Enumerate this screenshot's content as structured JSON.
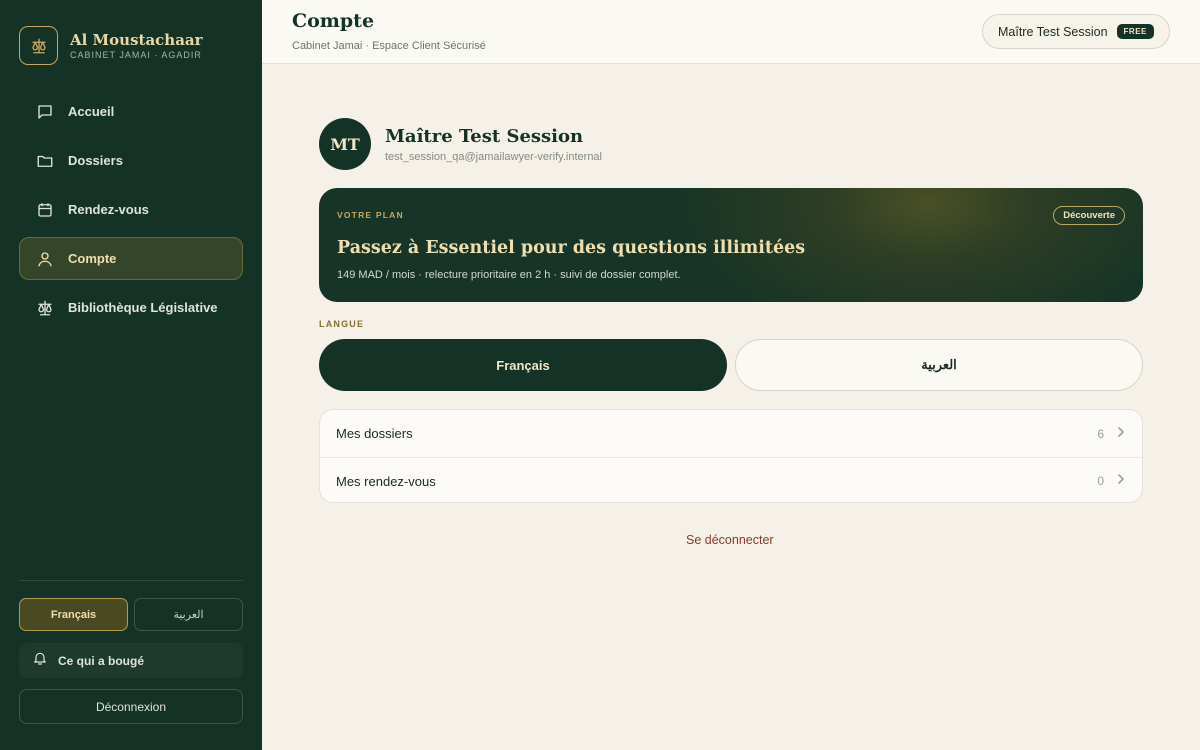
{
  "colors": {
    "sidebar_bg": "#143326",
    "accent_gold": "#c9a85c",
    "page_bg": "#f5f1e8",
    "logout_red": "#8a3b2a"
  },
  "brand": {
    "name": "Al Moustachaar",
    "subtitle": "CABINET JAMAI · AGADIR",
    "icon": "scales-icon"
  },
  "sidebar": {
    "items": [
      {
        "label": "Accueil",
        "icon": "message-square-icon",
        "active": false
      },
      {
        "label": "Dossiers",
        "icon": "folder-icon",
        "active": false
      },
      {
        "label": "Rendez-vous",
        "icon": "calendar-icon",
        "active": false
      },
      {
        "label": "Compte",
        "icon": "user-icon",
        "active": true
      },
      {
        "label": "Bibliothèque Législative",
        "icon": "scales-icon",
        "active": false
      }
    ],
    "lang_fr": "Français",
    "lang_ar": "العربية",
    "news_label": "Ce qui a bougé",
    "logout_label": "Déconnexion"
  },
  "header": {
    "title": "Compte",
    "subtitle": "Cabinet Jamai · Espace Client Sécurisé",
    "user_name": "Maître Test Session",
    "plan_badge": "FREE"
  },
  "profile": {
    "initials": "MT",
    "name": "Maître Test Session",
    "email": "test_session_qa@jamailawyer-verify.internal"
  },
  "plan": {
    "kicker": "VOTRE PLAN",
    "pill": "Découverte",
    "title": "Passez à Essentiel pour des questions illimitées",
    "description": "149 MAD / mois · relecture prioritaire en 2 h · suivi de dossier complet."
  },
  "language": {
    "label": "LANGUE",
    "fr": "Français",
    "ar": "العربية",
    "selected": "fr"
  },
  "list": {
    "rows": [
      {
        "label": "Mes dossiers",
        "count": "6"
      },
      {
        "label": "Mes rendez-vous",
        "count": "0"
      }
    ]
  },
  "logout_link": "Se déconnecter"
}
